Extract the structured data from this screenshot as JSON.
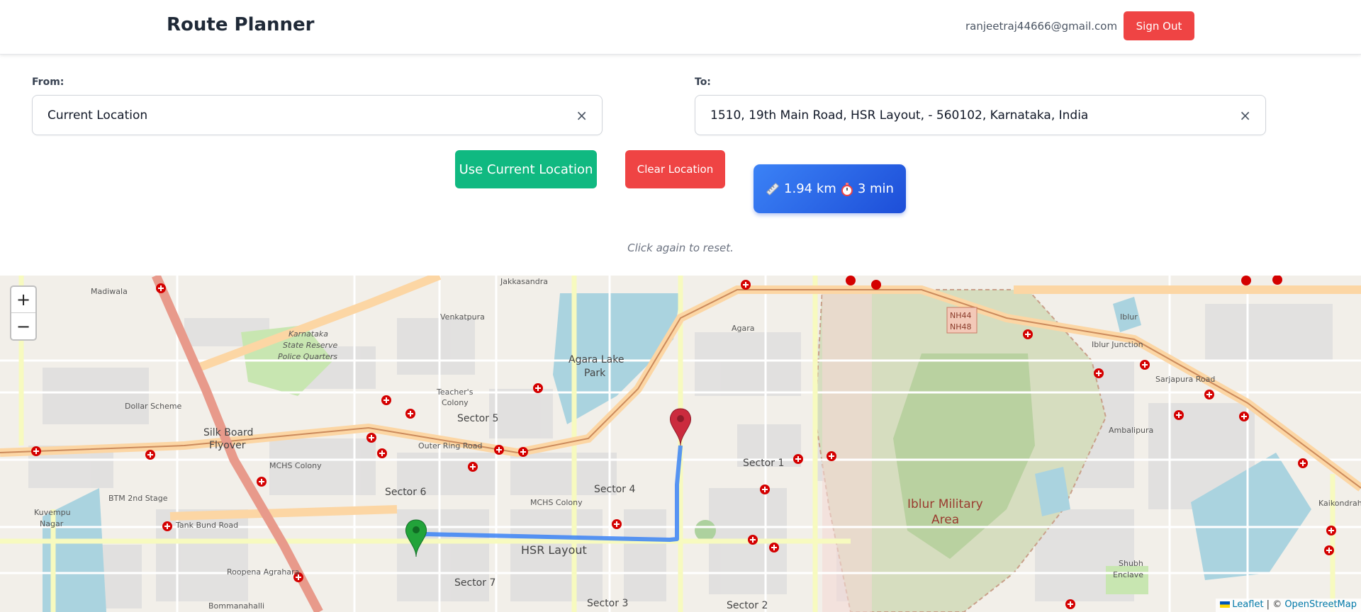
{
  "header": {
    "title": "Route Planner",
    "user_email": "ranjeetraj44666@gmail.com",
    "sign_out_label": "Sign Out"
  },
  "form": {
    "from_label": "From:",
    "from_value": "Current Location",
    "to_label": "To:",
    "to_value": "1510, 19th Main Road, HSR Layout, - 560102, Karnataka, India",
    "clear_glyph": "×"
  },
  "actions": {
    "use_current_location": "Use Current Location",
    "clear_location": "Clear Location"
  },
  "route": {
    "distance": "1.94 km",
    "duration": "3 min",
    "distance_icon": "ruler-icon",
    "duration_icon": "stopwatch-icon"
  },
  "hint": "Click again to reset.",
  "map": {
    "zoom_in": "+",
    "zoom_out": "−",
    "attribution_leaflet": "Leaflet",
    "attribution_sep": " | © ",
    "attribution_osm": "OpenStreetMap",
    "labels": {
      "agara_lake": "Agara Lake",
      "agara_park": "Park",
      "hsr_layout": "HSR Layout",
      "iblur_1": "Iblur Military",
      "iblur_2": "Area",
      "silk_board_1": "Silk Board",
      "silk_board_2": "Flyover",
      "outer_ring_road": "Outer Ring Road",
      "sarjapura_road": "Sarjapura Road",
      "btm": "BTM 2nd Stage",
      "sector_6": "Sector 6",
      "sector_5": "Sector 5",
      "sector_4": "Sector 4",
      "sector_7": "Sector 7",
      "sector_1": "Sector 1",
      "sector_2": "Sector 2",
      "sector_3": "Sector 3",
      "mchs": "MCHS Colony",
      "mchs2": "MCHS Colony",
      "agara": "Agara",
      "ambalipura": "Ambalipura",
      "iblur": "Iblur",
      "kaikondrahalli": "Kaikondrahalli",
      "bommanahalli": "Bommanahalli",
      "roopena": "Roopena Agrahara",
      "kuvempu": "Kuvempu",
      "nagar": "Nagar",
      "madiwala": "Madiwala",
      "karnataka": "Karnataka",
      "state_reserve": "State Reserve",
      "police_quarters": "Police Quarters",
      "venkatpura": "Venkatpura",
      "teachers": "Teacher's",
      "colony": "Colony",
      "dollar": "Dollar Scheme",
      "tank_bund": "Tank Bund Road",
      "jakkasandra": "Jakkasandra",
      "shubh": "Shubh",
      "enclave": "Enclave",
      "iblur_junction": "Iblur Junction",
      "nh44": "NH44",
      "nh48": "NH48"
    },
    "colors": {
      "route": "#3b82f6",
      "start_marker": "#22a33a",
      "end_marker": "#cb2b3e"
    }
  }
}
